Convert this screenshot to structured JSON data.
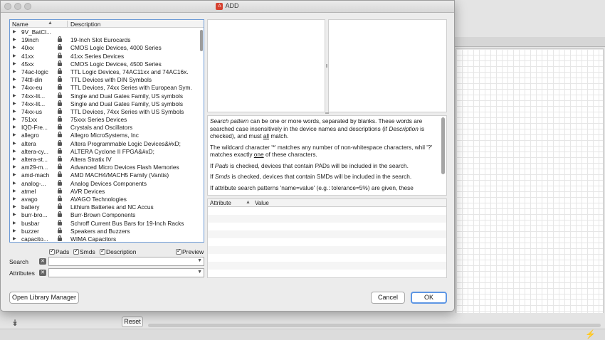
{
  "dialog": {
    "title": "ADD",
    "tree": {
      "col_name": "Name",
      "col_description": "Description",
      "rows": [
        {
          "name": "9V_BatCl...",
          "desc": "",
          "lock": false
        },
        {
          "name": "19inch",
          "desc": "19-Inch Slot Eurocards",
          "lock": true
        },
        {
          "name": "40xx",
          "desc": "CMOS Logic Devices, 4000 Series",
          "lock": true
        },
        {
          "name": "41xx",
          "desc": "41xx Series Devices",
          "lock": true
        },
        {
          "name": "45xx",
          "desc": "CMOS Logic Devices, 4500 Series",
          "lock": true
        },
        {
          "name": "74ac-logic",
          "desc": "TTL Logic Devices, 74AC11xx and 74AC16x.",
          "lock": true
        },
        {
          "name": "74ttl-din",
          "desc": "TTL Devices with DIN Symbols",
          "lock": true
        },
        {
          "name": "74xx-eu",
          "desc": "TTL Devices, 74xx Series with European Sym.",
          "lock": true
        },
        {
          "name": "74xx-lit...",
          "desc": "Single and Dual Gates Family, US symbols",
          "lock": true
        },
        {
          "name": "74xx-lit...",
          "desc": "Single and Dual Gates Family, US symbols",
          "lock": true
        },
        {
          "name": "74xx-us",
          "desc": "TTL Devices, 74xx Series with US Symbols",
          "lock": true
        },
        {
          "name": "751xx",
          "desc": "75xxx Series Devices",
          "lock": true
        },
        {
          "name": "IQD-Fre...",
          "desc": "Crystals and Oscillators",
          "lock": true
        },
        {
          "name": "allegro",
          "desc": "Allegro MicroSystems, Inc",
          "lock": true
        },
        {
          "name": "altera",
          "desc": "Altera Programmable Logic Devices&#xD;",
          "lock": true
        },
        {
          "name": "altera-cy...",
          "desc": "ALTERA Cyclone II FPGA&#xD;",
          "lock": true
        },
        {
          "name": "altera-st...",
          "desc": "Altera Stratix IV",
          "lock": true
        },
        {
          "name": "am29-m...",
          "desc": "Advanced Micro Devices Flash Memories",
          "lock": true
        },
        {
          "name": "amd-mach",
          "desc": "AMD MACH4/MACH5 Family (Vantis)",
          "lock": true
        },
        {
          "name": "analog-...",
          "desc": "Analog Devices Components",
          "lock": true
        },
        {
          "name": "atmel",
          "desc": "AVR Devices",
          "lock": true
        },
        {
          "name": "avago",
          "desc": "AVAGO Technologies",
          "lock": true
        },
        {
          "name": "battery",
          "desc": "Lithium Batteries and NC Accus",
          "lock": true
        },
        {
          "name": "burr-bro...",
          "desc": "Burr-Brown Components",
          "lock": true
        },
        {
          "name": "busbar",
          "desc": "Schroff Current Bus Bars for 19-Inch Racks",
          "lock": true
        },
        {
          "name": "buzzer",
          "desc": "Speakers and Buzzers",
          "lock": true
        },
        {
          "name": "capacito...",
          "desc": "WIMA Capacitors",
          "lock": true
        }
      ]
    },
    "help": {
      "p1_a": "Search pattern",
      "p1_b": " can be one or more words, separated by blanks. These words are searched case insensitively in the device names and descriptions (if ",
      "p1_c": "Description",
      "p1_d": " is checked), and must ",
      "p1_e": "all",
      "p1_f": " match.",
      "p2_a": "The wildcard character '*' matches any number of non-whitespace characters, whil '?' matches exactly ",
      "p2_b": "one",
      "p2_c": " of these characters.",
      "p3_a": "If ",
      "p3_b": "Pads",
      "p3_c": " is checked, devices that contain PADs will be included in the search.",
      "p4_a": "If ",
      "p4_b": "Smds",
      "p4_c": " is checked, devices that contain SMDs will be included in the search.",
      "p5": "If attribute search patterns 'name=value' (e.g.: tolerance=5%) are given, these"
    },
    "attr_table": {
      "col_attribute": "Attribute",
      "col_value": "Value"
    },
    "checkboxes": {
      "pads": "Pads",
      "smds": "Smds",
      "description": "Description",
      "preview": "Preview"
    },
    "search": {
      "label": "Search",
      "value": "",
      "placeholder": ""
    },
    "attributes": {
      "label": "Attributes",
      "value": "",
      "placeholder": ""
    },
    "buttons": {
      "open_library_manager": "Open Library Manager",
      "cancel": "Cancel",
      "ok": "OK"
    }
  },
  "background": {
    "reset_label": "Reset",
    "expand_icon": "double-chevron-down-icon",
    "status_icon": "lightning-icon"
  },
  "colors": {
    "selection_border": "#6d9bd6",
    "default_button_border": "#5d96e4",
    "title_icon": "#d6412f"
  }
}
